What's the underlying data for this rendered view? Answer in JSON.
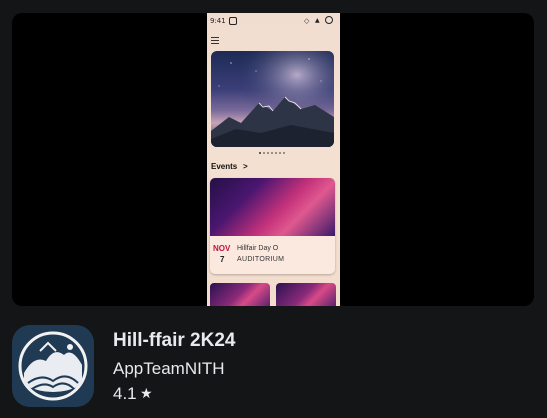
{
  "phone": {
    "status_time": "9:41",
    "events_label": "Events",
    "event": {
      "month": "NOV",
      "day": "7",
      "title": "Hillfair Day O",
      "venue": "AUDITORIUM"
    }
  },
  "app": {
    "title": "Hill-ffair 2K24",
    "developer": "AppTeamNITH",
    "rating": "4.1",
    "star_glyph": "★",
    "chevron_glyph": ">"
  },
  "icons": {
    "menu": "menu-icon",
    "wifi": "wifi-icon",
    "signal": "signal-icon",
    "battery": "battery-icon",
    "instagram": "instagram-icon",
    "star": "star-icon",
    "chevron": "chevron-right-icon"
  },
  "colors": {
    "background": "#131517",
    "text": "#e8eaed",
    "accent_month": "#c0143c",
    "app_icon_bg": "#213a54"
  }
}
